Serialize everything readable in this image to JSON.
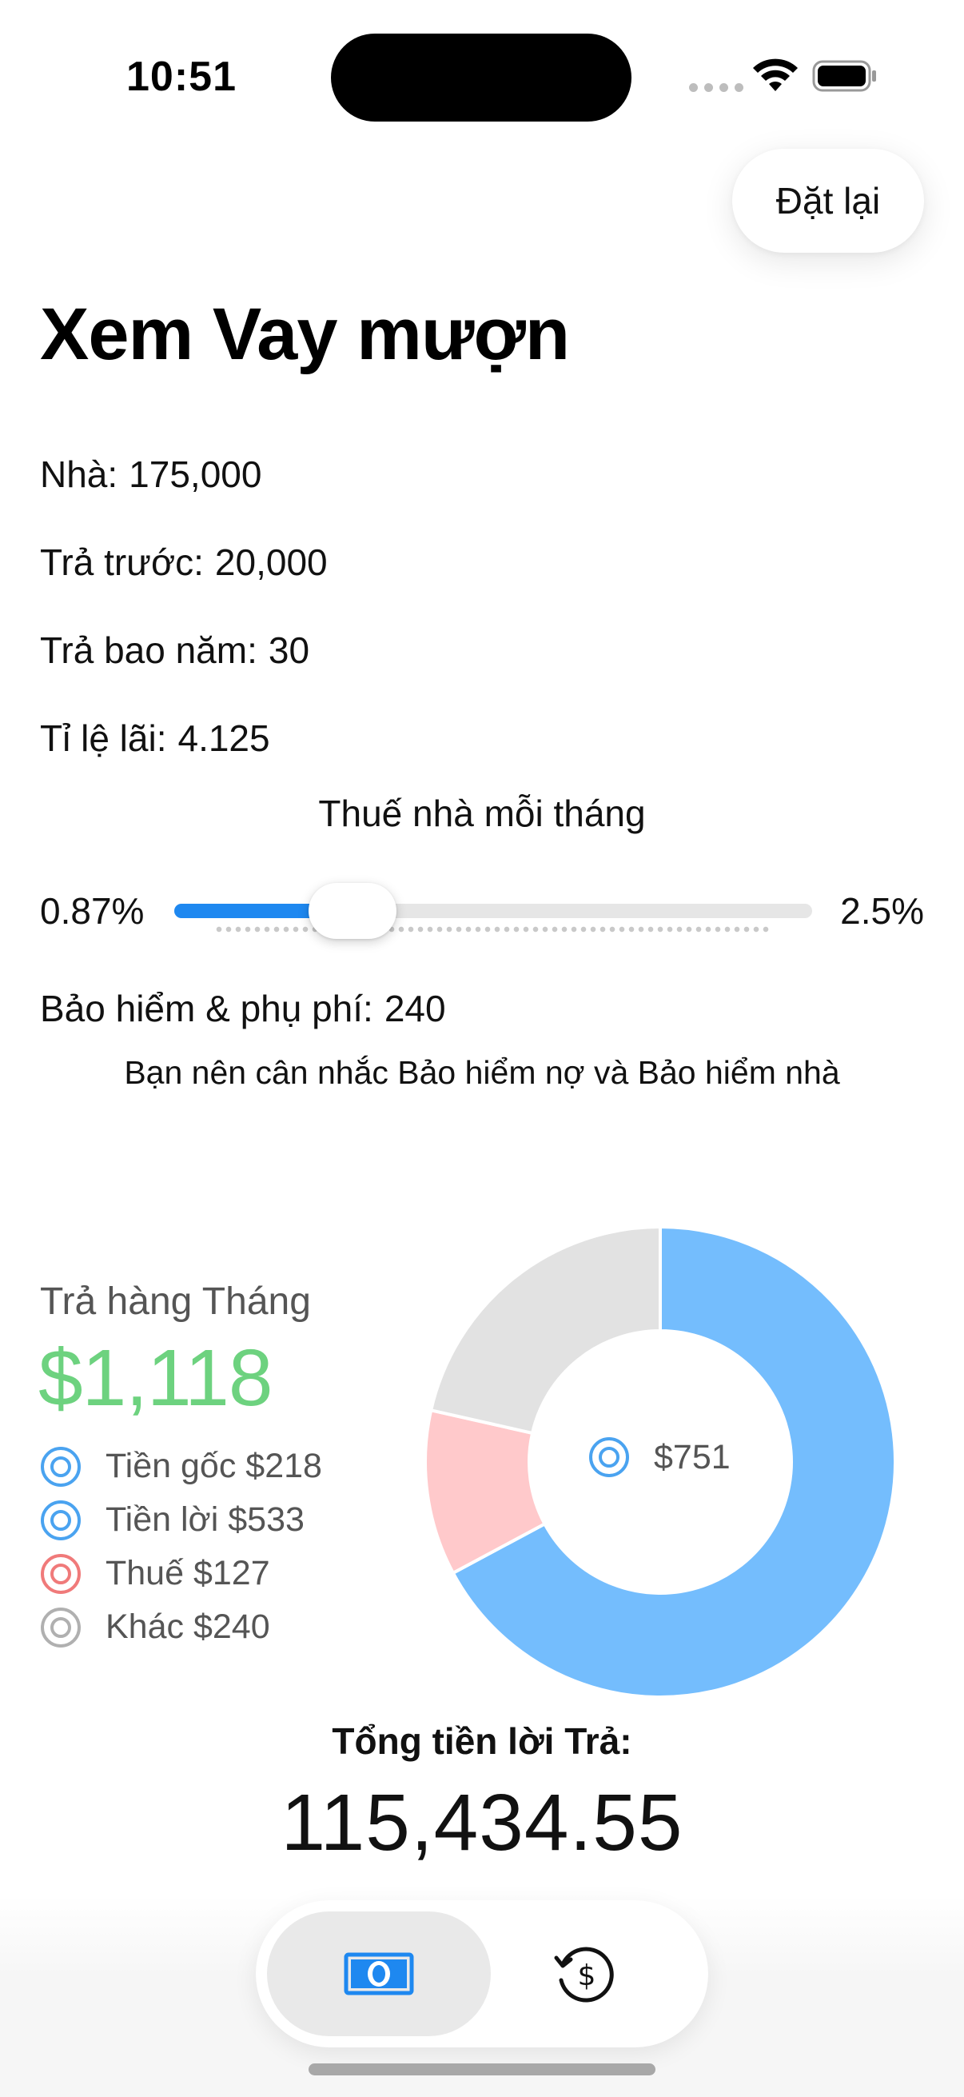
{
  "status_bar": {
    "time": "10:51"
  },
  "header": {
    "reset_label": "Đặt lại",
    "title": "Xem Vay mượn"
  },
  "fields": [
    {
      "label": "Nhà:",
      "value": "175,000"
    },
    {
      "label": "Trả trước:",
      "value": "20,000"
    },
    {
      "label": "Trả bao năm:",
      "value": "30"
    },
    {
      "label": "Tỉ lệ lãi:",
      "value": "4.125"
    }
  ],
  "tax_slider": {
    "title": "Thuế nhà mỗi tháng",
    "min_label": "0.87%",
    "max_label": "2.5%",
    "value_fraction": 0.28,
    "accent": "#1e88f0"
  },
  "insurance": {
    "label": "Bảo hiểm & phụ phí:",
    "value": "240"
  },
  "advice": "Bạn nên cân nhắc Bảo hiểm nợ và Bảo hiểm nhà",
  "monthly": {
    "label": "Trả hàng Tháng",
    "amount": "$1,118",
    "amount_color": "#6dd27f",
    "legend": [
      {
        "label": "Tiền gốc $218",
        "color": "#4aa3f0"
      },
      {
        "label": "Tiền lời $533",
        "color": "#4aa3f0"
      },
      {
        "label": "Thuế $127",
        "color": "#f07a7a"
      },
      {
        "label": "Khác $240",
        "color": "#b0b0b0"
      }
    ],
    "center_label": "$751"
  },
  "chart_data": {
    "type": "pie",
    "title": "",
    "slices": [
      {
        "name": "Tiền gốc + Tiền lời",
        "value": 751,
        "color": "#74bdfd"
      },
      {
        "name": "Thuế",
        "value": 127,
        "color": "#ffc9cb"
      },
      {
        "name": "Khác",
        "value": 240,
        "color": "#e2e2e2"
      }
    ],
    "donut": true
  },
  "total": {
    "label": "Tổng tiền lời Trả:",
    "value": "115,434.55"
  },
  "tabs": [
    {
      "icon": "banknote-icon",
      "selected": true,
      "color": "#1e88f0"
    },
    {
      "icon": "dollar-history-icon",
      "selected": false,
      "color": "#111111"
    }
  ]
}
